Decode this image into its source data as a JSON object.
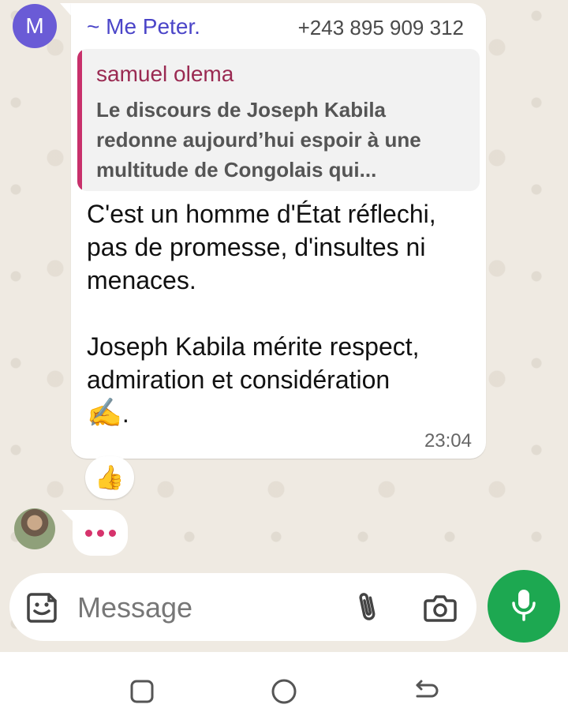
{
  "message": {
    "sender_initial": "M",
    "sender_name": "~ Me Peter.",
    "sender_phone": "+243 895 909 312",
    "quote": {
      "author": "samuel olema",
      "text": "Le discours de Joseph Kabila redonne aujourd’hui espoir à une multitude de Congolais qui..."
    },
    "paragraph1": "C'est un homme d'État réflechi, pas de promesse, d'insultes ni menaces.",
    "paragraph2": "Joseph Kabila mérite respect, admiration et considération",
    "writing_emoji": "✍️",
    "trailing_punct": ".",
    "time": "23:04"
  },
  "reaction": {
    "emoji": "👍"
  },
  "typing": {
    "label": "•••"
  },
  "input": {
    "placeholder": "Message"
  },
  "icons": {
    "sticker": "sticker-icon",
    "attach": "paperclip-icon",
    "camera": "camera-icon",
    "mic": "microphone-icon",
    "nav_recents": "recents-square-icon",
    "nav_home": "home-circle-icon",
    "nav_back": "back-arrow-icon"
  },
  "colors": {
    "sender_name": "#4b45c8",
    "quote_bar": "#c8306b",
    "quote_author": "#9a2a52",
    "typing_dots": "#d6336c",
    "mic_button": "#1da851",
    "avatar_m": "#6a5bd6"
  }
}
